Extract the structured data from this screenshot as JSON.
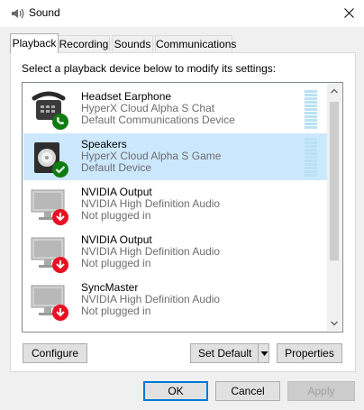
{
  "window": {
    "title": "Sound"
  },
  "tabs": [
    {
      "label": "Playback",
      "active": true
    },
    {
      "label": "Recording",
      "active": false
    },
    {
      "label": "Sounds",
      "active": false
    },
    {
      "label": "Communications",
      "active": false
    }
  ],
  "instruction": "Select a playback device below to modify its settings:",
  "devices": [
    {
      "name": "Headset Earphone",
      "description": "HyperX Cloud Alpha S Chat",
      "status": "Default Communications Device",
      "icon": "headset-phone-icon",
      "badge": "phone-badge-icon",
      "selected": false
    },
    {
      "name": "Speakers",
      "description": "HyperX Cloud Alpha S Game",
      "status": "Default Device",
      "icon": "speaker-icon",
      "badge": "check-badge-icon",
      "selected": true
    },
    {
      "name": "NVIDIA Output",
      "description": "NVIDIA High Definition Audio",
      "status": "Not plugged in",
      "icon": "monitor-icon",
      "badge": "unplugged-badge-icon",
      "selected": false
    },
    {
      "name": "NVIDIA Output",
      "description": "NVIDIA High Definition Audio",
      "status": "Not plugged in",
      "icon": "monitor-icon",
      "badge": "unplugged-badge-icon",
      "selected": false
    },
    {
      "name": "SyncMaster",
      "description": "NVIDIA High Definition Audio",
      "status": "Not plugged in",
      "icon": "monitor-icon",
      "badge": "unplugged-badge-icon",
      "selected": false
    }
  ],
  "buttons": {
    "configure": "Configure",
    "set_default": "Set Default",
    "properties": "Properties",
    "ok": "OK",
    "cancel": "Cancel",
    "apply": "Apply"
  },
  "colors": {
    "selection": "#cce8ff",
    "accent": "#0078d7",
    "status_green": "#107c10",
    "unplugged_red": "#e81123"
  }
}
